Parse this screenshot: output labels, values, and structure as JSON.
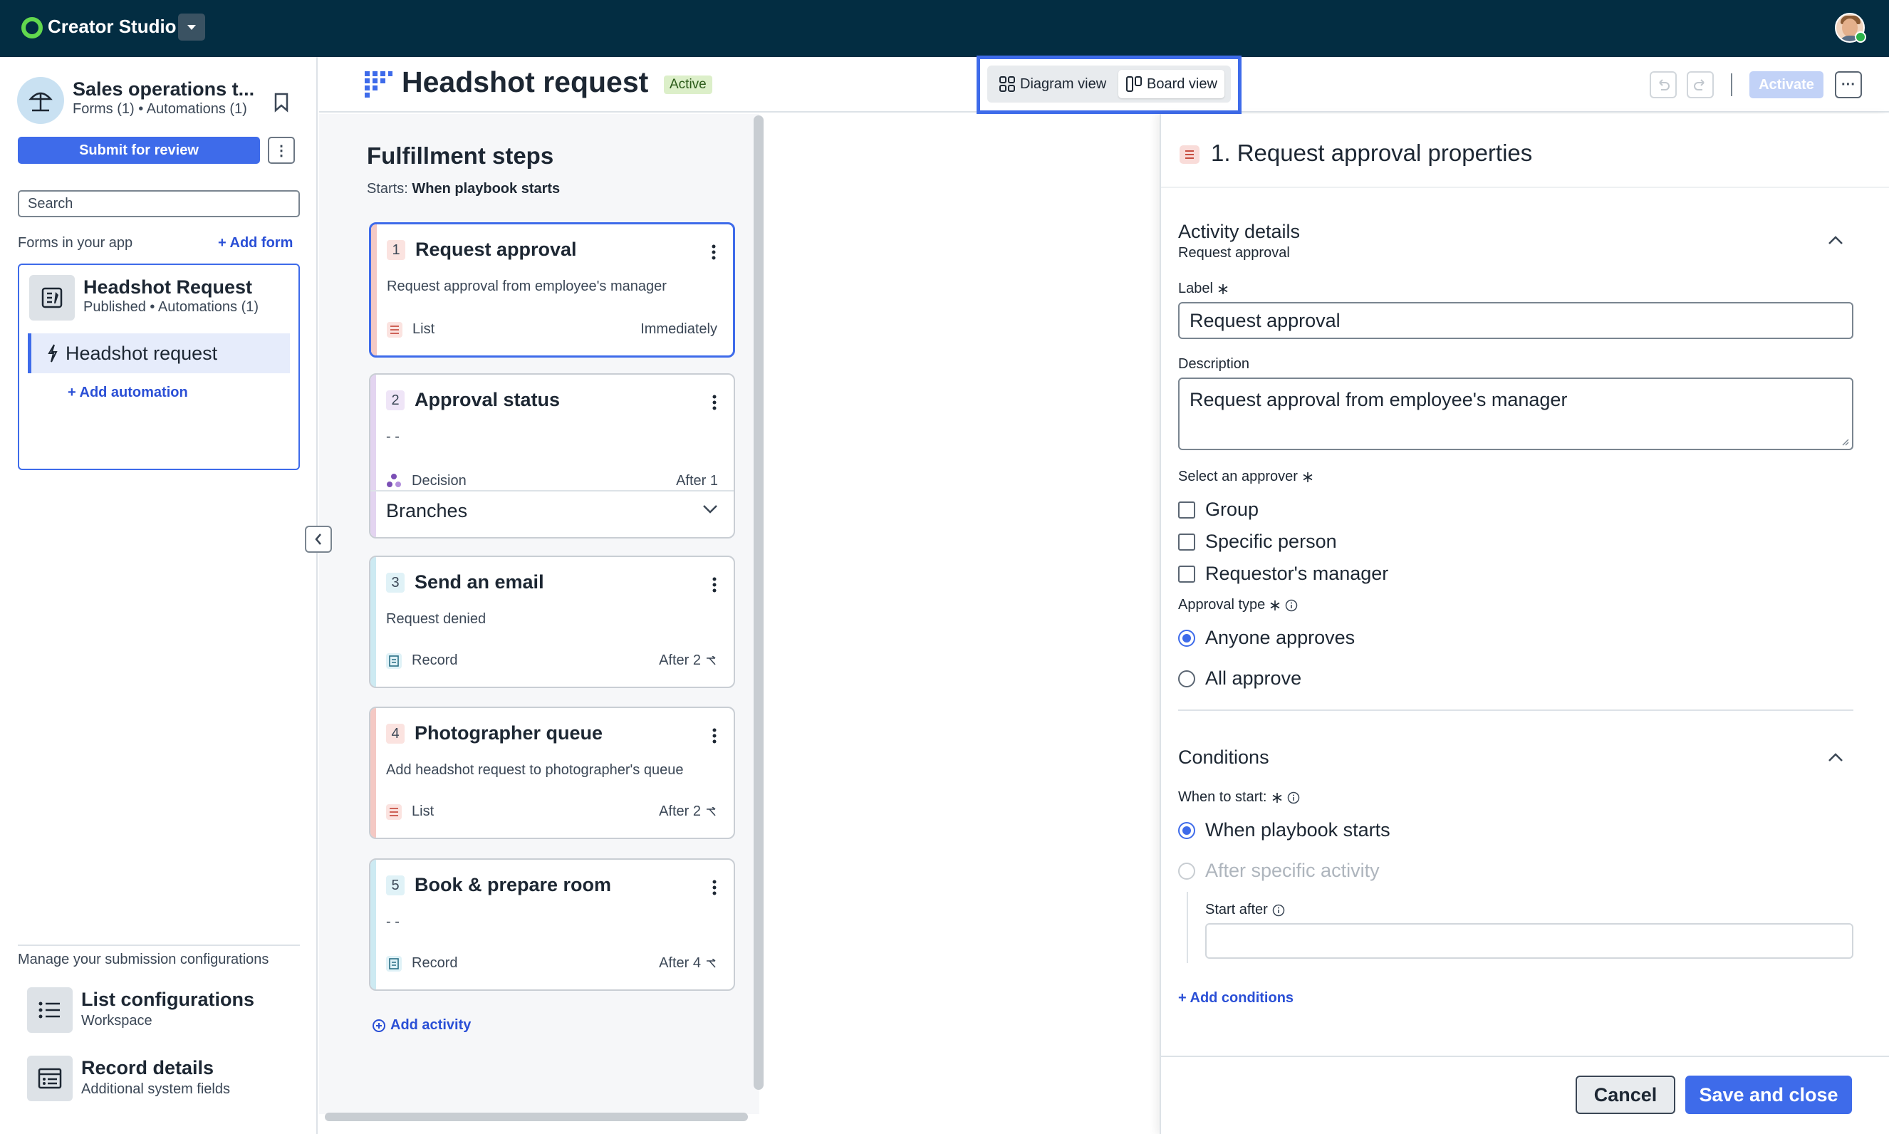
{
  "topbar": {
    "brand": "Creator Studio",
    "brand_color": "#62d84e",
    "background": "#032d42"
  },
  "sidebar": {
    "app_title": "Sales operations t...",
    "app_sub": "Forms (1) • Automations (1)",
    "submit_label": "Submit for review",
    "kebab_label": "⋮",
    "search_placeholder": "Search",
    "forms_label": "Forms in your app",
    "add_form_label": "+ Add form",
    "form": {
      "title": "Headshot Request",
      "sub": "Published • Automations (1)",
      "automation": "Headshot request",
      "add_automation_label": "+ Add automation"
    },
    "manage_label": "Manage your submission configurations",
    "configs": [
      {
        "title": "List configurations",
        "sub": "Workspace",
        "icon": "list-icon"
      },
      {
        "title": "Record details",
        "sub": "Additional system fields",
        "icon": "record-icon"
      }
    ]
  },
  "header": {
    "title": "Headshot request",
    "status": "Active",
    "view_diagram": "Diagram view",
    "view_board": "Board view",
    "activate_label": "Activate",
    "more_label": "···",
    "accent": "#3e6bea"
  },
  "steps": {
    "title": "Fulfillment steps",
    "starts_prefix": "Starts:",
    "starts_value": "When playbook starts",
    "items": [
      {
        "num": "1",
        "title": "Request approval",
        "desc": "Request approval from employee's manager",
        "type": "List",
        "timing": "Immediately",
        "accent": "#f4c9c4"
      },
      {
        "num": "2",
        "title": "Approval status",
        "desc": "- -",
        "type": "Decision",
        "timing": "After 1",
        "accent": "#e3d4f0",
        "branches": "Branches"
      },
      {
        "num": "3",
        "title": "Send an email",
        "desc": "Request denied",
        "type": "Record",
        "timing": "After 2",
        "accent": "#cdeaf2"
      },
      {
        "num": "4",
        "title": "Photographer queue",
        "desc": "Add headshot request to photographer's queue",
        "type": "List",
        "timing": "After 2",
        "accent": "#f4c9c4"
      },
      {
        "num": "5",
        "title": "Book & prepare room",
        "desc": "- -",
        "type": "Record",
        "timing": "After 4",
        "accent": "#cdeaf2"
      }
    ],
    "add_activity_label": "Add activity"
  },
  "props": {
    "title": "1. Request approval properties",
    "activity": {
      "title": "Activity details",
      "sub": "Request approval",
      "label_label": "Label",
      "label_value": "Request approval",
      "desc_label": "Description",
      "desc_value": "Request approval from employee's manager",
      "approver_label": "Select an approver",
      "approvers": [
        "Group",
        "Specific person",
        "Requestor's manager"
      ],
      "approval_type_label": "Approval type",
      "approval_types": [
        "Anyone approves",
        "All approve"
      ]
    },
    "conditions": {
      "title": "Conditions",
      "when_label": "When to start:",
      "options": [
        "When playbook starts",
        "After specific activity"
      ],
      "start_after_label": "Start after",
      "add_conditions_label": "+ Add conditions"
    },
    "cancel_label": "Cancel",
    "save_label": "Save and close"
  }
}
